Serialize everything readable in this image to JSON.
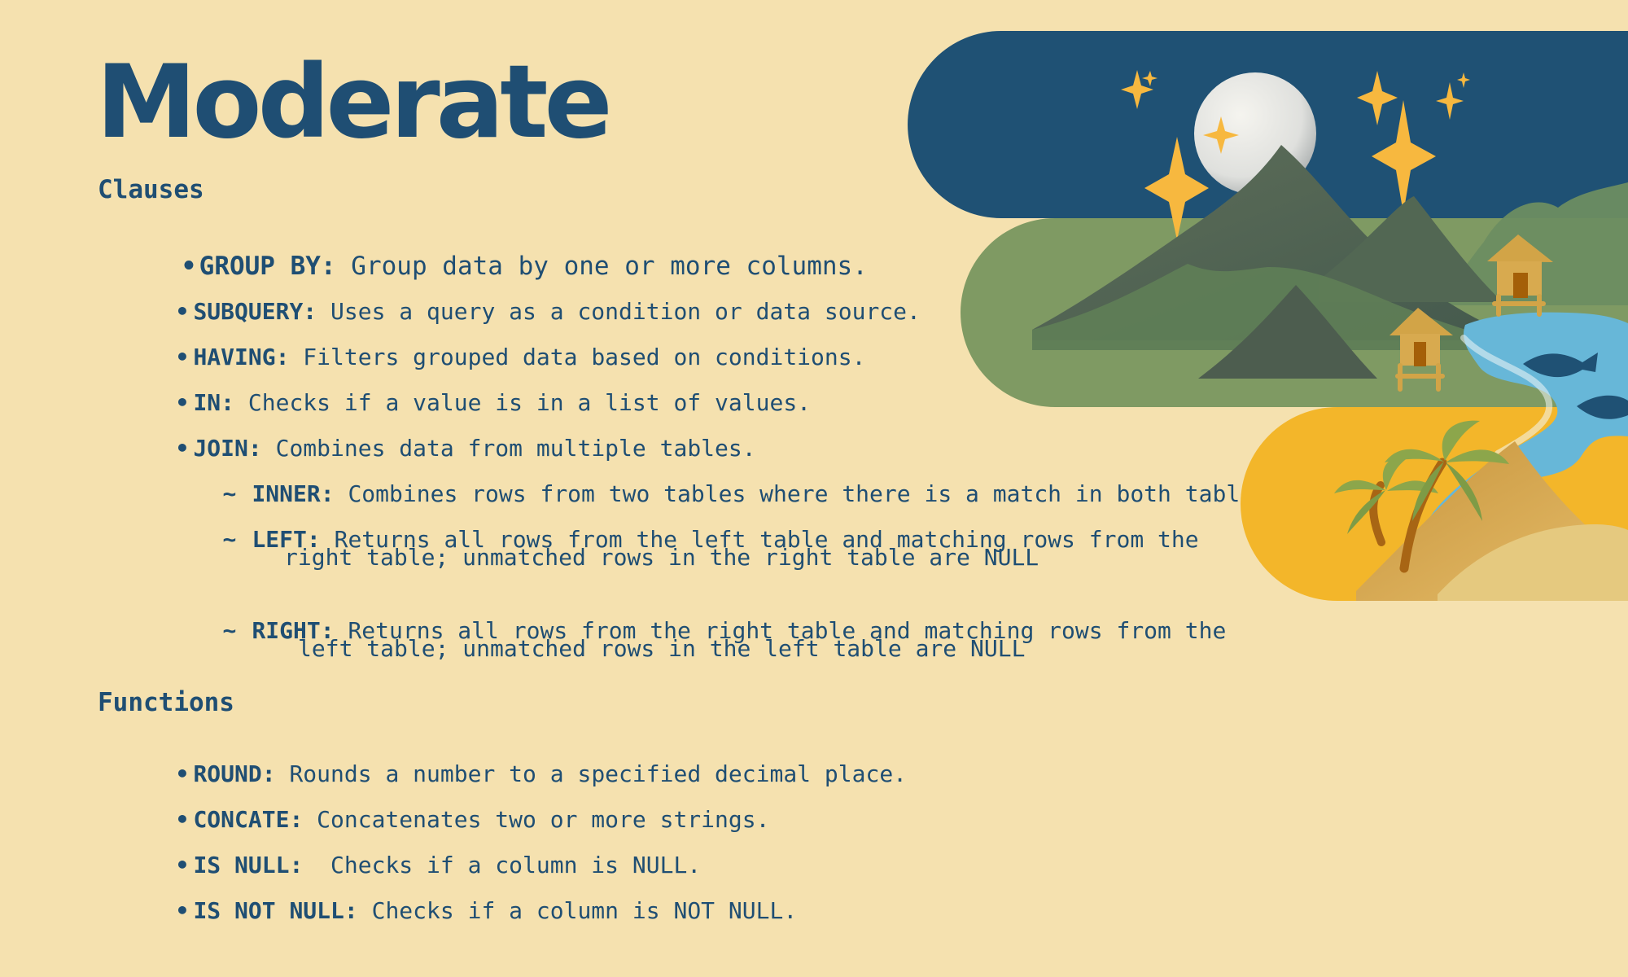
{
  "slide": {
    "title": "Moderate",
    "colors": {
      "background": "#f5e1af",
      "text": "#1f4e73",
      "night_band": "#1f5174",
      "green_band": "#7f9a63",
      "yellow_band": "#f3b62a",
      "river": "#67b7d8"
    }
  },
  "clauses": {
    "heading": "Clauses",
    "items": [
      {
        "term": "GROUP BY:",
        "description": " Group data by one or more columns."
      },
      {
        "term": "SUBQUERY:",
        "description": " Uses a query as a condition or data source."
      },
      {
        "term": "HAVING:",
        "description": " Filters grouped data based on conditions."
      },
      {
        "term": "IN:",
        "description": " Checks if a value is in a list of values."
      },
      {
        "term": "JOIN:",
        "description": " Combines data from multiple tables."
      }
    ],
    "join_types": [
      {
        "term": "INNER:",
        "description": " Combines rows from two tables where there is a match in both tables"
      },
      {
        "term": "LEFT:",
        "description": " Returns all rows from the left table and matching rows from the",
        "continuation": "right table; unmatched rows in the right table are NULL"
      },
      {
        "term": "RIGHT:",
        "description": " Returns all rows from the right table and matching rows from the",
        "continuation": "left table; unmatched rows in the left table are NULL"
      }
    ]
  },
  "functions": {
    "heading": "Functions",
    "items": [
      {
        "term": "ROUND:",
        "description": " Rounds a number to a specified decimal place."
      },
      {
        "term": "CONCATE:",
        "description": " Concatenates two or more strings."
      },
      {
        "term": "IS NULL:",
        "description": "  Checks if a column is NULL."
      },
      {
        "term": "IS NOT NULL:",
        "description": " Checks if a column is NOT NULL."
      }
    ]
  },
  "illustration": {
    "icon": "moon-mountains-river-village-illustration"
  }
}
